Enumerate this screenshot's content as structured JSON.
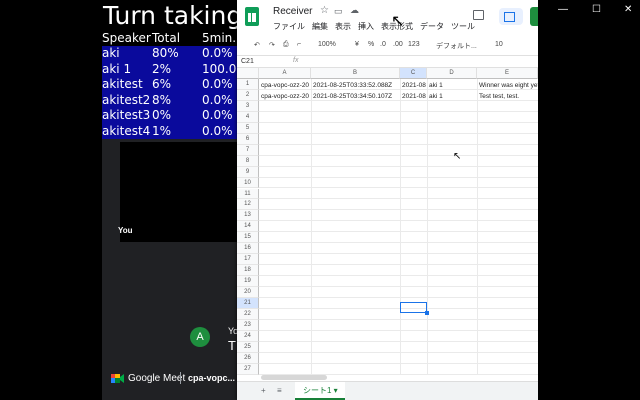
{
  "turn_taking": {
    "title": "Turn taking",
    "headers": [
      "Speaker",
      "Total",
      "5min."
    ],
    "rows": [
      {
        "speaker": "aki",
        "total": "80%",
        "recent": "0.0%"
      },
      {
        "speaker": "aki 1",
        "total": "2%",
        "recent": "100.0%"
      },
      {
        "speaker": "akitest",
        "total": "6%",
        "recent": "0.0%"
      },
      {
        "speaker": "akitest2",
        "total": "8%",
        "recent": "0.0%"
      },
      {
        "speaker": "akitest3",
        "total": "0%",
        "recent": "0.0%"
      },
      {
        "speaker": "akitest4",
        "total": "1%",
        "recent": "0.0%"
      }
    ]
  },
  "meet": {
    "tile_label": "You",
    "avatar_letter": "A",
    "caption_name": "Yo",
    "caption_text": "T",
    "brand": "Google Meet",
    "meeting_code": "cpa-vopc..."
  },
  "sheet": {
    "doc_title": "Receiver",
    "menu": [
      "ファイル",
      "編集",
      "表示",
      "挿入",
      "表示形式",
      "データ",
      "ツール"
    ],
    "toolbar": {
      "zoom": "100%",
      "currency": "¥",
      "percent": "%",
      "dec_minus": ".0",
      "dec_plus": ".00",
      "format": "123",
      "font": "デフォルト...",
      "font_size": "10"
    },
    "cell_ref": "C21",
    "fx_label": "fx",
    "columns": [
      "A",
      "B",
      "C",
      "D",
      "E"
    ],
    "row_numbers": [
      "1",
      "2",
      "3",
      "4",
      "5",
      "6",
      "7",
      "8",
      "9",
      "10",
      "11",
      "12",
      "13",
      "14",
      "15",
      "16",
      "17",
      "18",
      "19",
      "20",
      "21",
      "22",
      "23",
      "24",
      "25",
      "26",
      "27"
    ],
    "rows": [
      {
        "a": "cpa-vopc-ozz-20",
        "b": "2021-08-25T03:33:52.088Z",
        "c": "2021-08",
        "d": "aki 1",
        "e": "Winner was eight yet"
      },
      {
        "a": "cpa-vopc-ozz-20",
        "b": "2021-08-25T03:34:50.107Z",
        "c": "2021-08",
        "d": "aki 1",
        "e": "Test test, test."
      }
    ],
    "sheet_tab": "シート1",
    "add_sheet": "+",
    "all_sheets": "≡"
  },
  "colors": {
    "accent": "#1a73e8",
    "sheets_green": "#0f9d58",
    "turn_table_bg": "#0a0a9c"
  }
}
